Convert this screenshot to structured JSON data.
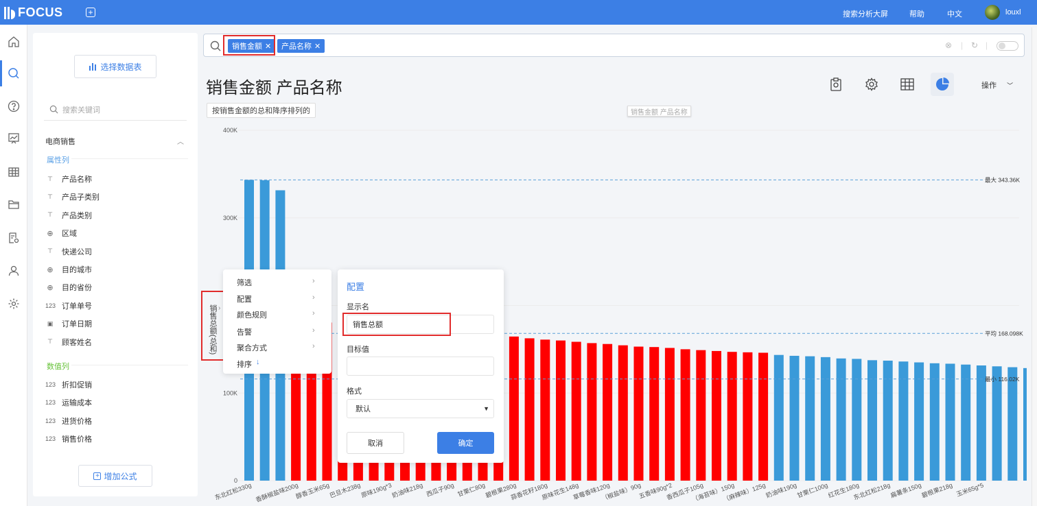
{
  "app": {
    "logo": "FOCUS"
  },
  "topbar": {
    "links": [
      "搜索分析大屏",
      "帮助",
      "中文"
    ],
    "user": "louxl"
  },
  "side": {
    "select_table_label": "选择数据表",
    "search_placeholder": "搜索关键词",
    "group_title": "电商销售",
    "attr_label": "属性列",
    "attr_fields": [
      {
        "type": "T",
        "name": "产品名称"
      },
      {
        "type": "T",
        "name": "产品子类别"
      },
      {
        "type": "T",
        "name": "产品类别"
      },
      {
        "type": "globe",
        "name": "区域"
      },
      {
        "type": "T",
        "name": "快递公司"
      },
      {
        "type": "globe",
        "name": "目的城市"
      },
      {
        "type": "globe",
        "name": "目的省份"
      },
      {
        "type": "123",
        "name": "订单单号"
      },
      {
        "type": "cal",
        "name": "订单日期"
      },
      {
        "type": "T",
        "name": "顾客姓名"
      }
    ],
    "num_label": "数值列",
    "num_fields": [
      {
        "type": "123",
        "name": "折扣促销"
      },
      {
        "type": "123",
        "name": "运输成本"
      },
      {
        "type": "123",
        "name": "进货价格"
      },
      {
        "type": "123",
        "name": "销售价格"
      }
    ],
    "add_formula_label": "增加公式"
  },
  "search": {
    "chips": [
      "销售金额",
      "产品名称"
    ]
  },
  "main": {
    "title": "销售金额 产品名称",
    "sort_hint": "按销售金额的总和降序排列的",
    "ghost_label": "销售金额 产品名称",
    "ops_label": "操作"
  },
  "colors": {
    "accent": "#3c7fe5",
    "bar_blue": "#3a9ad9",
    "bar_red": "#ff0000",
    "highlight": "#e12b2b"
  },
  "context_menu": {
    "items": [
      "筛选",
      "配置",
      "颜色规则",
      "告警",
      "聚合方式",
      "排序"
    ]
  },
  "config_panel": {
    "title": "配置",
    "display_name_label": "显示名",
    "display_name_value": "销售总额",
    "target_label": "目标值",
    "target_value": "",
    "format_label": "格式",
    "format_value": "默认",
    "cancel_label": "取消",
    "ok_label": "确定"
  },
  "chart_data": {
    "type": "bar",
    "ylabel": "销售总额(总和)",
    "ylim": [
      0,
      400000
    ],
    "yticks": [
      "0",
      "100K",
      "300K",
      "400K"
    ],
    "ref_lines": [
      {
        "label": "最大 343.36K",
        "value": 343360
      },
      {
        "label": "平均 168.098K",
        "value": 168098
      },
      {
        "label": "最小 116.02K",
        "value": 116020
      }
    ],
    "values": [
      343360,
      343000,
      331500,
      182000,
      181000,
      180500,
      180000,
      179500,
      179000,
      178500,
      178000,
      177500,
      177000,
      176500,
      172000,
      165000,
      164800,
      164500,
      162500,
      161000,
      160000,
      158500,
      157000,
      156000,
      154500,
      153000,
      152500,
      151500,
      150000,
      149000,
      148000,
      147000,
      146500,
      146000,
      143500,
      142500,
      142000,
      141000,
      139500,
      139000,
      137500,
      137000,
      136000,
      135000,
      134000,
      133500,
      132500,
      131500,
      130500,
      129500,
      128500
    ],
    "colors": [
      "blue",
      "blue",
      "blue",
      "red",
      "red",
      "red",
      "red",
      "red",
      "red",
      "red",
      "red",
      "red",
      "red",
      "red",
      "red",
      "red",
      "red",
      "red",
      "red",
      "red",
      "red",
      "red",
      "red",
      "red",
      "red",
      "red",
      "red",
      "red",
      "red",
      "red",
      "red",
      "red",
      "red",
      "red",
      "blue",
      "blue",
      "blue",
      "blue",
      "blue",
      "blue",
      "blue",
      "blue",
      "blue",
      "blue",
      "blue",
      "blue",
      "blue",
      "blue",
      "blue",
      "blue",
      "blue"
    ],
    "categories": [
      "东北红松330g",
      "",
      "",
      "香酥椒盐味200g",
      "",
      "醇香玉米65g",
      "",
      "巴旦木238g",
      "",
      "原味190g*3",
      "",
      "奶油味218g",
      "",
      "西瓜子90g",
      "",
      "甘栗仁80g",
      "",
      "碧根果280g",
      "",
      "蒜香花籽180g",
      "",
      "原味花生148g",
      "",
      "草莓香味120g",
      "",
      "（椒盐味）90g",
      "",
      "五香味90g*2",
      "",
      "香西瓜子105g",
      "",
      "（海苔味）150g",
      "",
      "（麻辣味）125g",
      "",
      "奶油味190g",
      "",
      "甘栗仁100g",
      "",
      "红花生180g",
      "",
      "东北红松218g",
      "",
      "扁薯条150g",
      "",
      "碧根果218g",
      "",
      "玉米65g*5"
    ]
  }
}
